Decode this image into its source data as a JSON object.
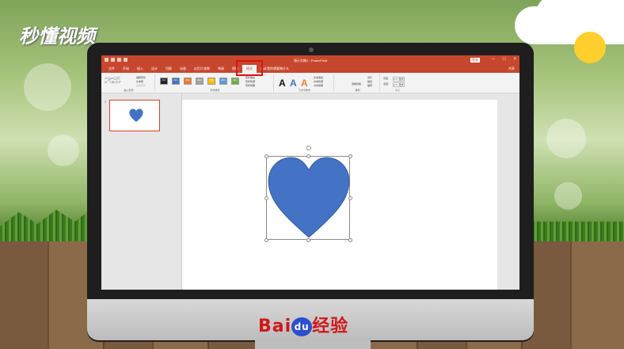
{
  "watermark": "秒懂视频",
  "brand": {
    "text": "Bai",
    "paw_text": "du",
    "suffix": "经验"
  },
  "app": {
    "title": "演示文稿1 - PowerPoint",
    "login_label": "登录",
    "share_label": "共享"
  },
  "tabs": [
    "文件",
    "开始",
    "插入",
    "设计",
    "切换",
    "动画",
    "幻灯片放映",
    "审阅",
    "视图",
    "格式",
    "告诉我你想要做什么"
  ],
  "active_tab_index": 9,
  "ribbon": {
    "group_insert_shapes": "插入形状",
    "edit_shape": "编辑形状",
    "text_box": "文本框",
    "merge_shapes": "合并形状",
    "group_shape_styles": "形状样式",
    "style_swatches": [
      "Abc",
      "Abc",
      "Abc",
      "Abc",
      "Abc",
      "Abc",
      "Abc"
    ],
    "shape_fill": "形状填充",
    "shape_outline": "形状轮廓",
    "shape_effects": "形状效果",
    "group_wordart": "艺术字样式",
    "text_fill": "文本填充",
    "text_outline": "文本轮廓",
    "text_effects": "文本效果",
    "group_arrange": "排列",
    "selection_pane": "选择窗格",
    "align": "对齐",
    "group": "组合",
    "rotate": "旋转",
    "group_size": "大小",
    "height_label": "高度:",
    "height_value": "3.77 厘米",
    "width_label": "宽度:",
    "width_value": "3.77 厘米"
  },
  "slide_number": "1",
  "colors": {
    "accent": "#c7472e",
    "heart_fill": "#4472c4",
    "heart_stroke": "#2f5597",
    "highlight": "#e01010"
  },
  "icons": [
    "heart-icon",
    "rotate-handle-icon",
    "paw-icon"
  ]
}
